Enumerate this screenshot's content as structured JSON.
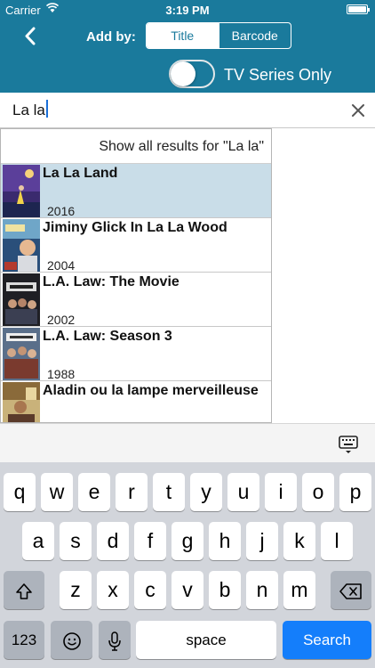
{
  "status_bar": {
    "carrier": "Carrier",
    "time": "3:19 PM",
    "battery_level": 1.0
  },
  "nav": {
    "back_icon": "chevron-left-icon",
    "add_by_label": "Add by:",
    "segments": [
      {
        "label": "Title",
        "selected": true
      },
      {
        "label": "Barcode",
        "selected": false
      }
    ],
    "toggle": {
      "label": "TV Series Only",
      "on": false
    }
  },
  "search": {
    "value": "La la",
    "clear_icon": "close-icon"
  },
  "results": {
    "show_all": "Show all results for \"La la\"",
    "items": [
      {
        "title": "La La Land",
        "year": "2016",
        "selected": true
      },
      {
        "title": "Jiminy Glick In La La Wood",
        "year": "2004",
        "selected": false
      },
      {
        "title": "L.A. Law: The Movie",
        "year": "2002",
        "selected": false
      },
      {
        "title": "L.A. Law: Season 3",
        "year": "1988",
        "selected": false
      },
      {
        "title": "Aladin ou la lampe merveilleuse",
        "year": "",
        "selected": false
      }
    ]
  },
  "keyboard": {
    "row1": [
      "q",
      "w",
      "e",
      "r",
      "t",
      "y",
      "u",
      "i",
      "o",
      "p"
    ],
    "row2": [
      "a",
      "s",
      "d",
      "f",
      "g",
      "h",
      "j",
      "k",
      "l"
    ],
    "row3": [
      "z",
      "x",
      "c",
      "v",
      "b",
      "n",
      "m"
    ],
    "numbers_label": "123",
    "space_label": "space",
    "search_label": "Search"
  },
  "colors": {
    "header": "#1a7a9c",
    "selected_row": "#c9dde8",
    "search_key": "#147efb"
  }
}
